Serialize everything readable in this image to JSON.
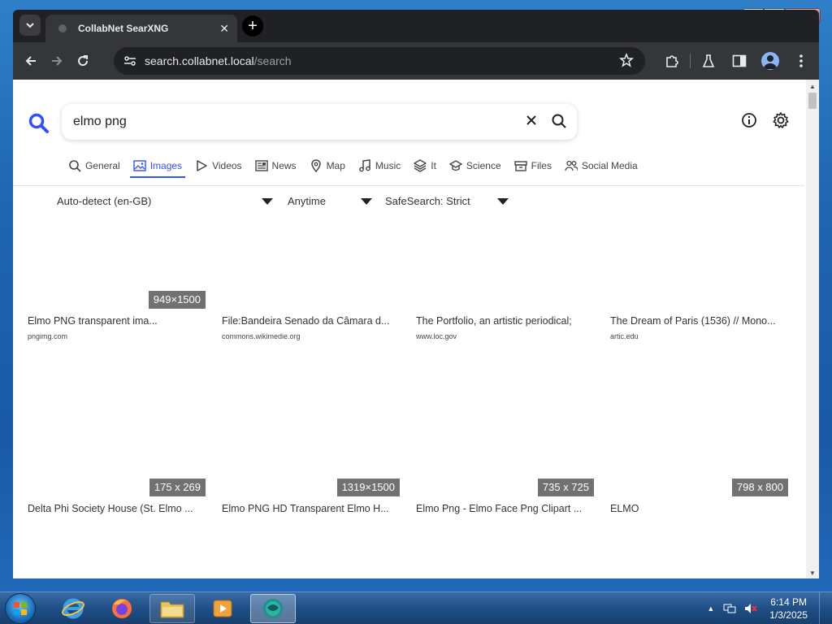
{
  "window": {
    "minimize_label": "▁",
    "maximize_label": "▢",
    "close_label": "✕"
  },
  "tab": {
    "title": "CollabNet SearXNG",
    "close": "✕",
    "new_tab": "+"
  },
  "toolbar": {
    "url_host": "search.collabnet.local",
    "url_path": "/search"
  },
  "search": {
    "query": "elmo png"
  },
  "categories": [
    {
      "label": "General",
      "icon": "magnifier-icon",
      "active": false
    },
    {
      "label": "Images",
      "icon": "image-icon",
      "active": true
    },
    {
      "label": "Videos",
      "icon": "play-icon",
      "active": false
    },
    {
      "label": "News",
      "icon": "newspaper-icon",
      "active": false
    },
    {
      "label": "Map",
      "icon": "map-pin-icon",
      "active": false
    },
    {
      "label": "Music",
      "icon": "music-note-icon",
      "active": false
    },
    {
      "label": "It",
      "icon": "layers-icon",
      "active": false
    },
    {
      "label": "Science",
      "icon": "graduation-cap-icon",
      "active": false
    },
    {
      "label": "Files",
      "icon": "archive-icon",
      "active": false
    },
    {
      "label": "Social Media",
      "icon": "people-icon",
      "active": false
    }
  ],
  "filters": {
    "language": "Auto-detect (en-GB)",
    "time": "Anytime",
    "safesearch": "SafeSearch: Strict"
  },
  "results": [
    {
      "dims": "949×1500",
      "title": "Elmo PNG transparent ima...",
      "url": "pngimg.com"
    },
    {
      "dims": "",
      "title": "File:Bandeira Senado da Câmara d...",
      "url": "commons.wikimedie.org"
    },
    {
      "dims": "",
      "title": "The Portfolio, an artistic periodical;",
      "url": "www.loc.gov"
    },
    {
      "dims": "",
      "title": "The Dream of Paris (1536) // Mono...",
      "url": "artic.edu"
    },
    {
      "dims": "175 x 269",
      "title": "Delta Phi Society House (St. Elmo ...",
      "url": ""
    },
    {
      "dims": "1319×1500",
      "title": "Elmo PNG HD Transparent Elmo H...",
      "url": ""
    },
    {
      "dims": "735 x 725",
      "title": "Elmo Png - Elmo Face Png Clipart ...",
      "url": ""
    },
    {
      "dims": "798 x 800",
      "title": "ELMO",
      "url": ""
    }
  ],
  "taskbar": {
    "apps": [
      "internet-explorer",
      "firefox",
      "file-explorer",
      "media-player",
      "active-app"
    ],
    "clock_time": "6:14 PM",
    "clock_date": "1/3/2025"
  },
  "colors": {
    "accent": "#3050ff",
    "dims_badge": "#717171"
  }
}
